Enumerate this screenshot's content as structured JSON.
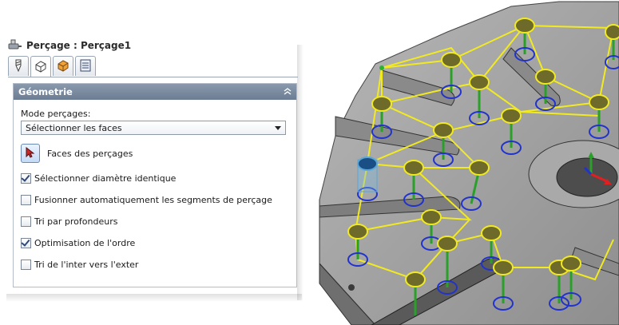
{
  "feature": {
    "title": "Perçage : Perçage1"
  },
  "tabs": [
    {
      "icon": "drill-bit-icon"
    },
    {
      "icon": "part-face-icon"
    },
    {
      "icon": "part-orange-icon"
    },
    {
      "icon": "list-icon"
    }
  ],
  "group": {
    "title": "Géometrie",
    "mode_label": "Mode perçages:",
    "mode_value": "Sélectionner les faces",
    "faces_label": "Faces des perçages",
    "options": [
      {
        "label": "Sélectionner diamètre identique",
        "checked": true
      },
      {
        "label": "Fusionner automatiquement les segments de perçage",
        "checked": false
      },
      {
        "label": "Tri par profondeurs",
        "checked": false
      },
      {
        "label": "Optimisation de l'ordre",
        "checked": true
      },
      {
        "label": "Tri de l'inter vers l'exter",
        "checked": false
      }
    ]
  },
  "colors": {
    "accent_header": "#7b8ba0",
    "toolpath": "#f2ea20",
    "hole_top": "#6d6a2a",
    "hole_ring": "#2233cc",
    "axis": "#2aa02a",
    "part": "#9d9d9d"
  }
}
